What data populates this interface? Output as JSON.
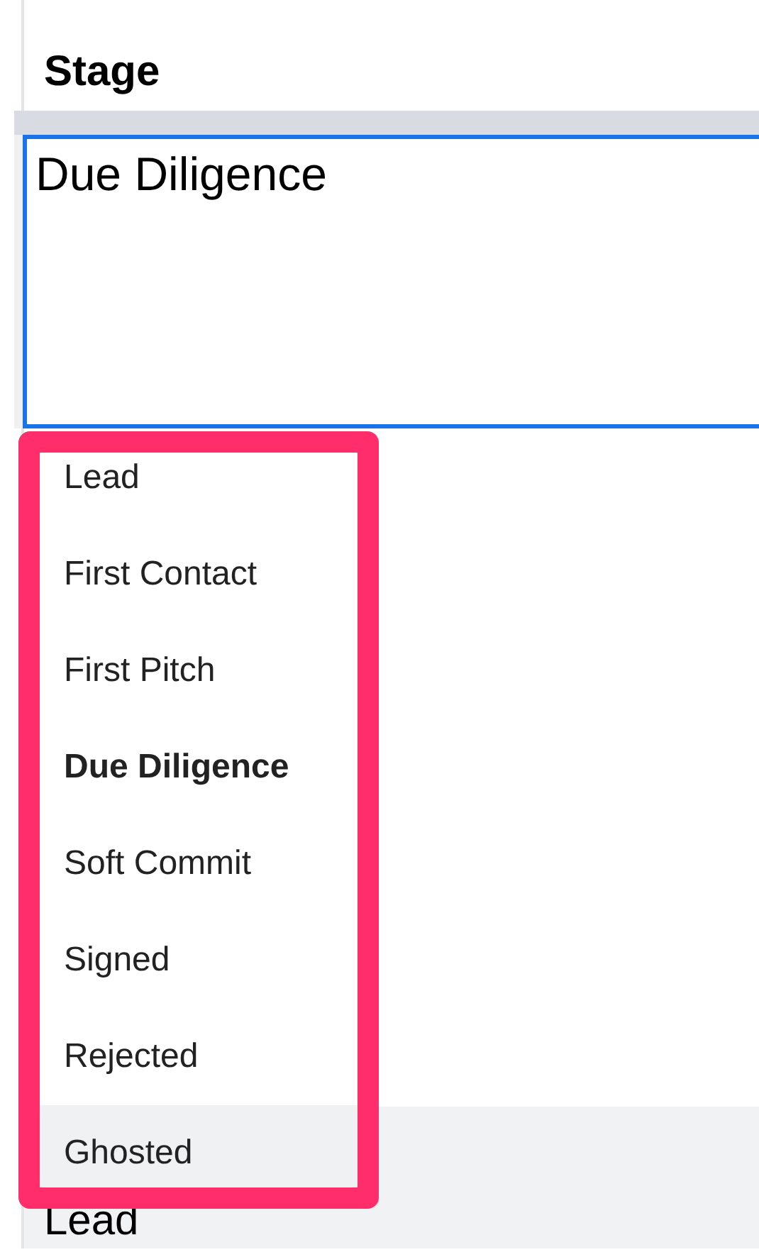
{
  "column_header": "Stage",
  "editor": {
    "value": "Due Diligence"
  },
  "dropdown": {
    "options": [
      {
        "label": "Lead",
        "selected": false,
        "highlighted": false
      },
      {
        "label": "First Contact",
        "selected": false,
        "highlighted": false
      },
      {
        "label": "First Pitch",
        "selected": false,
        "highlighted": false
      },
      {
        "label": "Due Diligence",
        "selected": true,
        "highlighted": false
      },
      {
        "label": "Soft Commit",
        "selected": false,
        "highlighted": false
      },
      {
        "label": "Signed",
        "selected": false,
        "highlighted": false
      },
      {
        "label": "Rejected",
        "selected": false,
        "highlighted": false
      },
      {
        "label": "Ghosted",
        "selected": false,
        "highlighted": true
      }
    ]
  },
  "next_row": {
    "cell": "Lead"
  }
}
